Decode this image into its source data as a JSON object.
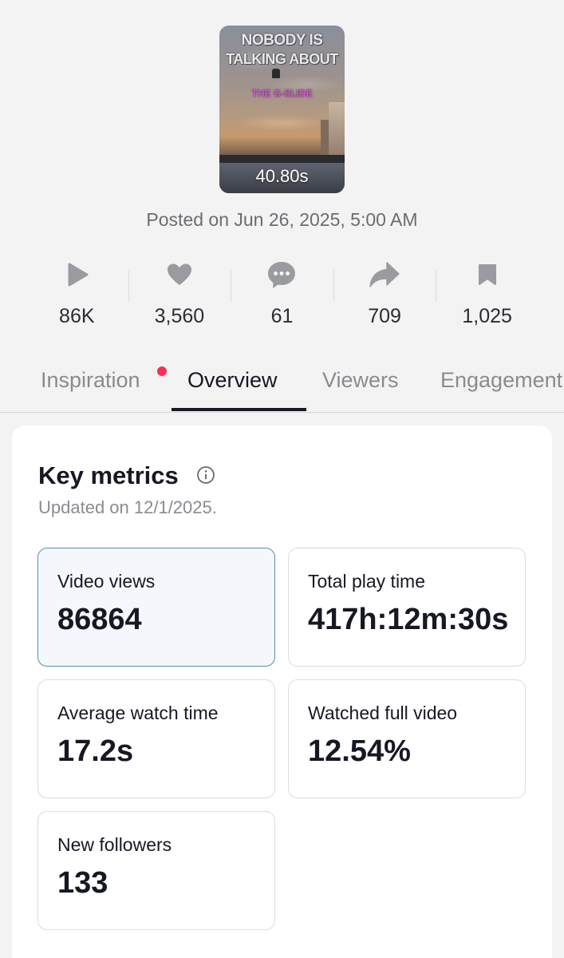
{
  "video": {
    "thumbnail_line1": "NOBODY IS",
    "thumbnail_line2": "TALKING ABOUT",
    "thumbnail_tag": "THE G-SLIDE",
    "duration": "40.80s",
    "posted": "Posted on Jun 26, 2025, 5:00 AM"
  },
  "stats": [
    {
      "icon": "play-icon",
      "value": "86K"
    },
    {
      "icon": "heart-icon",
      "value": "3,560"
    },
    {
      "icon": "comment-icon",
      "value": "61"
    },
    {
      "icon": "share-icon",
      "value": "709"
    },
    {
      "icon": "bookmark-icon",
      "value": "1,025"
    }
  ],
  "tabs": [
    {
      "label": "Inspiration",
      "has_notification_dot": true
    },
    {
      "label": "Overview",
      "active": true
    },
    {
      "label": "Viewers"
    },
    {
      "label": "Engagement"
    }
  ],
  "key_metrics": {
    "title": "Key metrics",
    "updated": "Updated on 12/1/2025.",
    "items": [
      {
        "label": "Video views",
        "value": "86864",
        "selected": true
      },
      {
        "label": "Total play time",
        "value": "417h:12m:30s"
      },
      {
        "label": "Average watch time",
        "value": "17.2s"
      },
      {
        "label": "Watched full video",
        "value": "12.54%"
      },
      {
        "label": "New followers",
        "value": "133"
      }
    ]
  },
  "colors": {
    "background": "#f3f3f3",
    "text": "#161823",
    "muted": "#8a8b91",
    "icon": "#9a9ba0",
    "notification_dot": "#fe2c55",
    "selected_border": "#5c8ea6"
  }
}
